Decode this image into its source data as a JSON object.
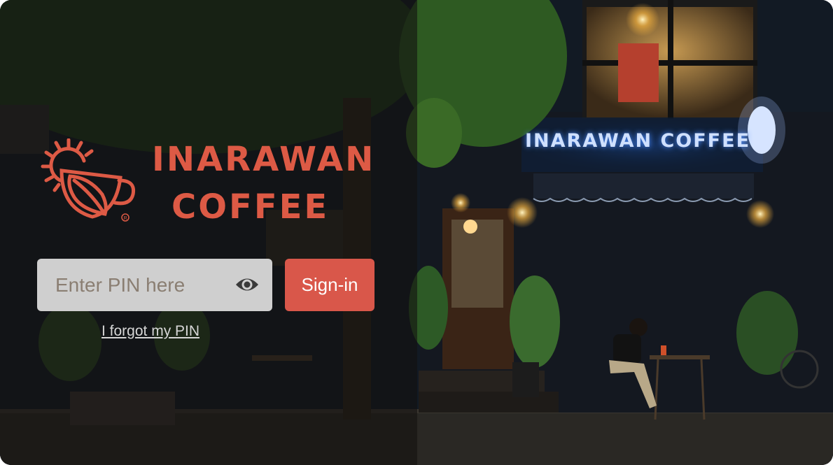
{
  "brand": {
    "name_line1": "INARAWAN",
    "name_line2": "COFFEE",
    "color": "#dd5a45"
  },
  "login": {
    "pin_placeholder": "Enter PIN here",
    "pin_value": "",
    "toggle_visibility_icon": "eye-icon",
    "signin_label": "Sign-in",
    "forgot_label": "I forgot my PIN",
    "button_color": "#d9574a"
  },
  "background": {
    "storefront_sign": "INARAWAN COFFEE"
  }
}
